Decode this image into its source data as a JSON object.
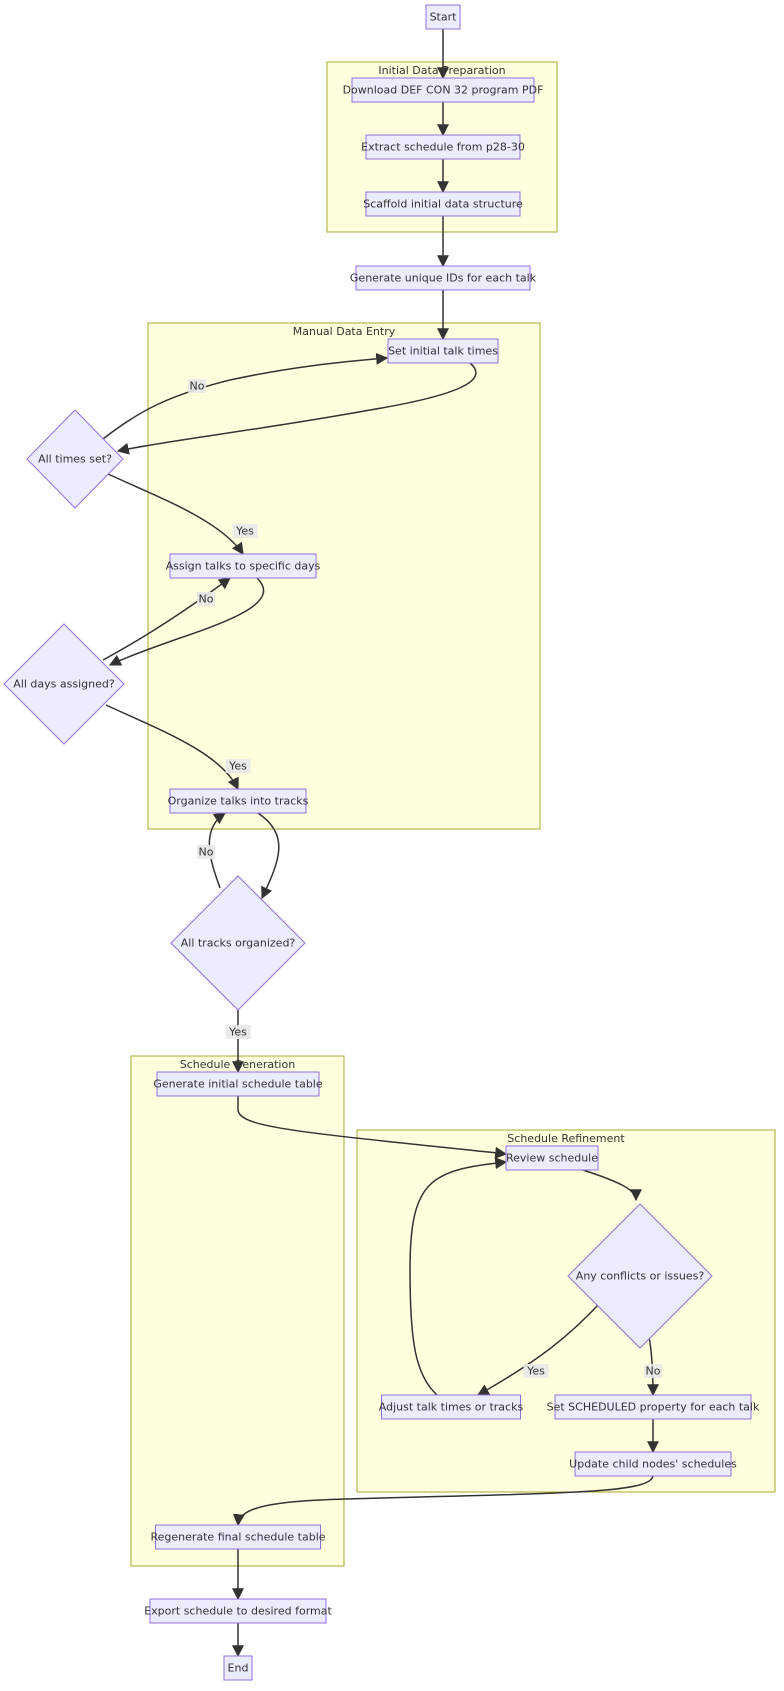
{
  "diagram": {
    "type": "flowchart",
    "colors": {
      "node_fill": "#ececff",
      "node_stroke": "#9370db",
      "cluster_fill": "#ffffde",
      "cluster_stroke": "#aaaa33",
      "edge": "#333333",
      "text": "#333333"
    },
    "clusters": [
      {
        "id": "prep",
        "label": "Initial Data Preparation"
      },
      {
        "id": "manual",
        "label": "Manual Data Entry"
      },
      {
        "id": "gen",
        "label": "Schedule Generation"
      },
      {
        "id": "refine",
        "label": "Schedule Refinement"
      }
    ],
    "nodes": [
      {
        "id": "start",
        "label": "Start",
        "shape": "rect"
      },
      {
        "id": "download",
        "label": "Download DEF CON 32 program PDF",
        "shape": "rect"
      },
      {
        "id": "extract",
        "label": "Extract schedule from p28-30",
        "shape": "rect"
      },
      {
        "id": "scaffold",
        "label": "Scaffold initial data structure",
        "shape": "rect"
      },
      {
        "id": "ids",
        "label": "Generate unique IDs for each talk",
        "shape": "rect"
      },
      {
        "id": "times",
        "label": "Set initial talk times",
        "shape": "rect"
      },
      {
        "id": "times_q",
        "label": "All times set?",
        "shape": "diamond"
      },
      {
        "id": "days",
        "label": "Assign talks to specific days",
        "shape": "rect"
      },
      {
        "id": "days_q",
        "label": "All days assigned?",
        "shape": "diamond"
      },
      {
        "id": "tracks",
        "label": "Organize talks into tracks",
        "shape": "rect"
      },
      {
        "id": "tracks_q",
        "label": "All tracks organized?",
        "shape": "diamond"
      },
      {
        "id": "gentable",
        "label": "Generate initial schedule table",
        "shape": "rect"
      },
      {
        "id": "review",
        "label": "Review schedule",
        "shape": "rect"
      },
      {
        "id": "conflicts_q",
        "label": "Any conflicts or issues?",
        "shape": "diamond"
      },
      {
        "id": "adjust",
        "label": "Adjust talk times or tracks",
        "shape": "rect"
      },
      {
        "id": "setsched",
        "label": "Set SCHEDULED property for each talk",
        "shape": "rect"
      },
      {
        "id": "update",
        "label": "Update child nodes' schedules",
        "shape": "rect"
      },
      {
        "id": "regen",
        "label": "Regenerate final schedule table",
        "shape": "rect"
      },
      {
        "id": "export",
        "label": "Export schedule to desired format",
        "shape": "rect"
      },
      {
        "id": "end",
        "label": "End",
        "shape": "rect"
      }
    ],
    "edges": [
      {
        "from": "start",
        "to": "download",
        "label": ""
      },
      {
        "from": "download",
        "to": "extract",
        "label": ""
      },
      {
        "from": "extract",
        "to": "scaffold",
        "label": ""
      },
      {
        "from": "scaffold",
        "to": "ids",
        "label": ""
      },
      {
        "from": "ids",
        "to": "times",
        "label": ""
      },
      {
        "from": "times",
        "to": "times_q",
        "label": ""
      },
      {
        "from": "times_q",
        "to": "times",
        "label": "No"
      },
      {
        "from": "times_q",
        "to": "days",
        "label": "Yes"
      },
      {
        "from": "days",
        "to": "days_q",
        "label": ""
      },
      {
        "from": "days_q",
        "to": "days",
        "label": "No"
      },
      {
        "from": "days_q",
        "to": "tracks",
        "label": "Yes"
      },
      {
        "from": "tracks",
        "to": "tracks_q",
        "label": ""
      },
      {
        "from": "tracks_q",
        "to": "tracks",
        "label": "No"
      },
      {
        "from": "tracks_q",
        "to": "gentable",
        "label": "Yes"
      },
      {
        "from": "gentable",
        "to": "review",
        "label": ""
      },
      {
        "from": "review",
        "to": "conflicts_q",
        "label": ""
      },
      {
        "from": "conflicts_q",
        "to": "adjust",
        "label": "Yes"
      },
      {
        "from": "conflicts_q",
        "to": "setsched",
        "label": "No"
      },
      {
        "from": "adjust",
        "to": "review",
        "label": ""
      },
      {
        "from": "setsched",
        "to": "update",
        "label": ""
      },
      {
        "from": "update",
        "to": "regen",
        "label": ""
      },
      {
        "from": "regen",
        "to": "export",
        "label": ""
      },
      {
        "from": "export",
        "to": "end",
        "label": ""
      }
    ]
  }
}
